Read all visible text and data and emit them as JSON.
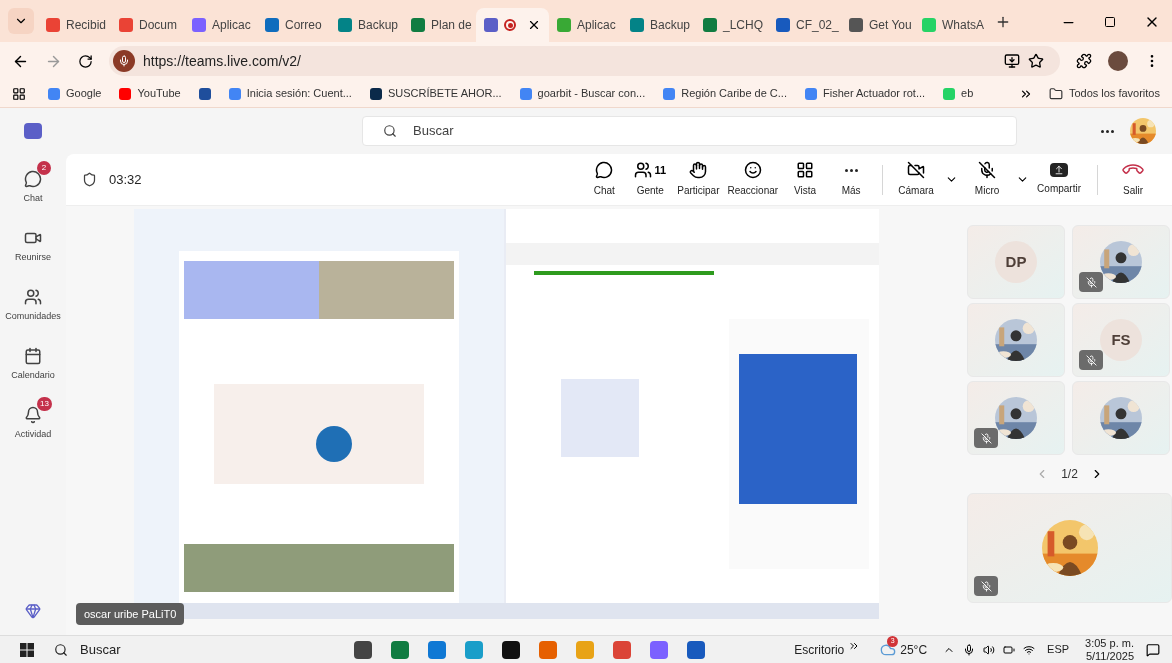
{
  "browser": {
    "tabs": [
      {
        "label": "Recibid",
        "color": "#ea4335",
        "selected": false,
        "recording": false
      },
      {
        "label": "Docum",
        "color": "#ea4335",
        "selected": false,
        "recording": false
      },
      {
        "label": "Aplicac",
        "color": "#7b61ff",
        "selected": false,
        "recording": false
      },
      {
        "label": "Correo",
        "color": "#0f6cbd",
        "selected": false,
        "recording": false
      },
      {
        "label": "Backup",
        "color": "#038387",
        "selected": false,
        "recording": false
      },
      {
        "label": "Plan de",
        "color": "#107c41",
        "selected": false,
        "recording": false
      },
      {
        "color": "#5b5fc7",
        "selected": true,
        "recording": true
      },
      {
        "label": "Aplicac",
        "color": "#39a935",
        "selected": false,
        "recording": false
      },
      {
        "label": "Backup",
        "color": "#038387",
        "selected": false,
        "recording": false
      },
      {
        "label": "_LCHQ",
        "color": "#107c41",
        "selected": false,
        "recording": false
      },
      {
        "label": "CF_02_",
        "color": "#185abd",
        "selected": false,
        "recording": false
      },
      {
        "label": "Get You",
        "color": "#555555",
        "selected": false,
        "recording": false
      },
      {
        "label": "WhatsA",
        "color": "#25d366",
        "selected": false,
        "recording": false
      }
    ],
    "address": "https://teams.live.com/v2/",
    "bookmarks": [
      {
        "label": "Google",
        "color": "#4285f4"
      },
      {
        "label": "YouTube",
        "color": "#ff0000"
      },
      {
        "color": "#1f4e9c"
      },
      {
        "label": "Inicia sesión: Cuent...",
        "color": "#4285f4"
      },
      {
        "label": "SUSCRÍBETE AHOR...",
        "color": "#0b2a4a"
      },
      {
        "label": "goarbit - Buscar con...",
        "color": "#4285f4"
      },
      {
        "label": "Región Caribe de C...",
        "color": "#4285f4"
      },
      {
        "label": "Fisher Actuador rot...",
        "color": "#4285f4"
      },
      {
        "label": "eb",
        "color": "#25d366"
      }
    ],
    "all_bookmarks": "Todos los favoritos"
  },
  "teams": {
    "search_placeholder": "Buscar",
    "rail": [
      {
        "kind": "chat",
        "label": "Chat",
        "badge": "2"
      },
      {
        "kind": "meet",
        "label": "Reunirse"
      },
      {
        "kind": "communities",
        "label": "Comunidades"
      },
      {
        "kind": "calendar",
        "label": "Calendario"
      },
      {
        "kind": "activity",
        "label": "Actividad",
        "badge": "13"
      }
    ]
  },
  "meeting": {
    "timer": "03:32",
    "controls": [
      {
        "kind": "chat",
        "label": "Chat"
      },
      {
        "kind": "people",
        "label": "Gente",
        "count": "11"
      },
      {
        "kind": "raise",
        "label": "Participar"
      },
      {
        "kind": "react",
        "label": "Reaccionar"
      },
      {
        "kind": "view",
        "label": "Vista"
      },
      {
        "kind": "more",
        "label": "Más"
      }
    ],
    "devices": [
      {
        "kind": "camera",
        "label": "Cámara",
        "on": false
      },
      {
        "kind": "mic",
        "label": "Micro",
        "on": false
      }
    ],
    "actions": [
      {
        "kind": "share",
        "label": "Compartir"
      },
      {
        "kind": "leave",
        "label": "Salir"
      }
    ],
    "shared_screen": {
      "kind": "picture"
    },
    "presenter": "oscar uribe PaLiT0",
    "participants": [
      {
        "kind": "initials",
        "initials": "DP",
        "muted": false
      },
      {
        "kind": "picture",
        "muted": true
      },
      {
        "kind": "picture",
        "muted": false
      },
      {
        "kind": "initials",
        "initials": "FS",
        "muted": true
      },
      {
        "kind": "picture",
        "muted": true
      },
      {
        "kind": "picture",
        "muted": false
      }
    ],
    "pager": "1/2",
    "self": {
      "kind": "picture",
      "muted": true
    }
  },
  "taskbar": {
    "search": "Buscar",
    "desktop": "Escritorio",
    "weather": "25°C",
    "weather_badge": "3",
    "language": "ESP",
    "time": "3:05 p. m.",
    "date": "5/11/2025"
  }
}
